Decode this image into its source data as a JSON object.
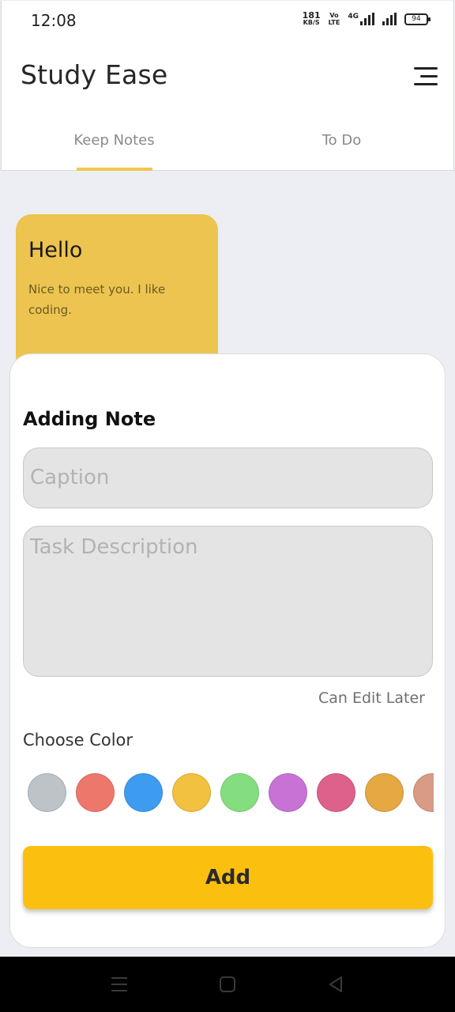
{
  "status_bar": {
    "time": "12:08",
    "net_speed_top": "181",
    "net_speed_bottom": "KB/S",
    "volte_top": "Vo",
    "volte_bottom": "LTE",
    "network": "4G",
    "battery": "94"
  },
  "header": {
    "app_title": "Study Ease",
    "menu_icon": "menu-icon"
  },
  "tabs": [
    {
      "label": "Keep Notes",
      "active": true
    },
    {
      "label": "To Do",
      "active": false
    }
  ],
  "note_card": {
    "title": "Hello",
    "body": "Nice to meet you. I like coding.",
    "color": "#ecc44f"
  },
  "sheet": {
    "title": "Adding Note",
    "caption_placeholder": "Caption",
    "description_placeholder": "Task Description",
    "edit_hint": "Can Edit Later",
    "choose_color_label": "Choose Color",
    "colors": [
      "#bdc3c7",
      "#ee776c",
      "#3d9cef",
      "#f2c13f",
      "#84de7f",
      "#c872d6",
      "#dc628c",
      "#e5a842",
      "#d99a86"
    ],
    "add_label": "Add"
  },
  "nav": {
    "icons": [
      "recents-icon",
      "home-icon",
      "back-icon"
    ]
  },
  "theme": {
    "accent": "#fbc00f",
    "tab_indicator": "#f1c94a",
    "background": "#eceef3"
  }
}
